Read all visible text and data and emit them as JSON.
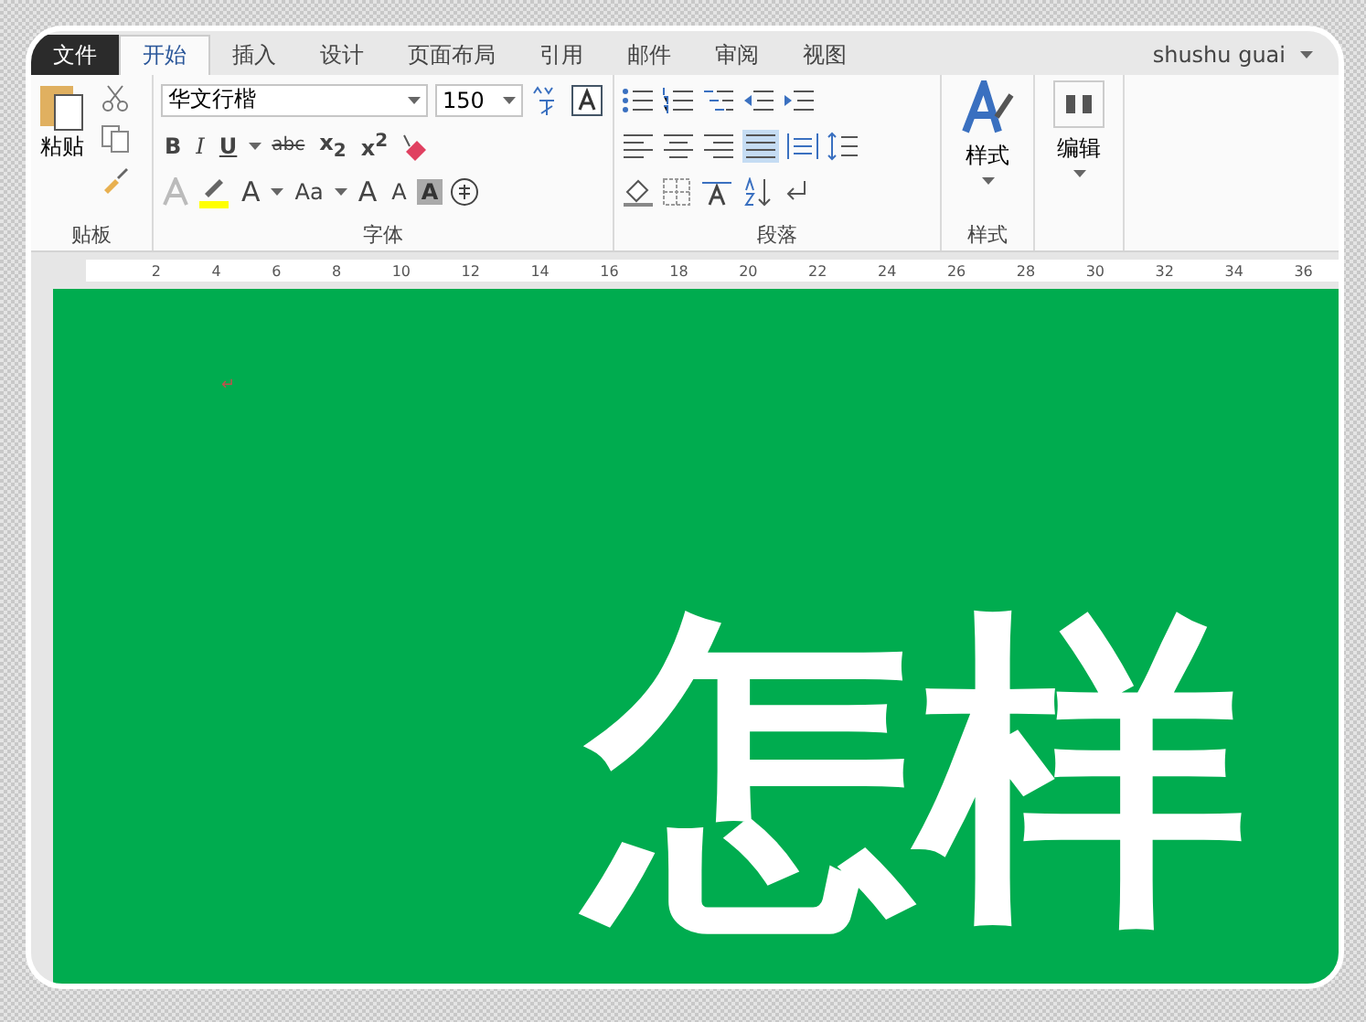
{
  "tabs": [
    {
      "label": "文件",
      "kind": "file",
      "selected": false
    },
    {
      "label": "开始",
      "kind": "tab",
      "selected": true
    },
    {
      "label": "插入",
      "kind": "tab",
      "selected": false
    },
    {
      "label": "设计",
      "kind": "tab",
      "selected": false
    },
    {
      "label": "页面布局",
      "kind": "tab",
      "selected": false
    },
    {
      "label": "引用",
      "kind": "tab",
      "selected": false
    },
    {
      "label": "邮件",
      "kind": "tab",
      "selected": false
    },
    {
      "label": "审阅",
      "kind": "tab",
      "selected": false
    },
    {
      "label": "视图",
      "kind": "tab",
      "selected": false
    }
  ],
  "user": {
    "name": "shushu guai"
  },
  "clipboard": {
    "paste": "粘贴",
    "label": "贴板"
  },
  "font": {
    "name": "华文行楷",
    "size": "150",
    "bold": "B",
    "italic": "I",
    "underline": "U",
    "strike": "abc",
    "subscript": "x$_{2}$",
    "superscript": "x$^{2}$",
    "font_color": "A",
    "change_case": "Aa",
    "grow": "A",
    "shrink": "A",
    "shading": "A",
    "label": "字体"
  },
  "paragraph": {
    "label": "段落",
    "align_justify_selected": true
  },
  "styles": {
    "button": "样式",
    "label": "样式"
  },
  "editing": {
    "button": "编辑"
  },
  "ruler": [
    "2",
    "4",
    "6",
    "8",
    "10",
    "12",
    "14",
    "16",
    "18",
    "20",
    "22",
    "24",
    "26",
    "28",
    "30",
    "32",
    "34",
    "36"
  ],
  "document": {
    "paragraph_mark": "↵",
    "text": "怎样"
  }
}
